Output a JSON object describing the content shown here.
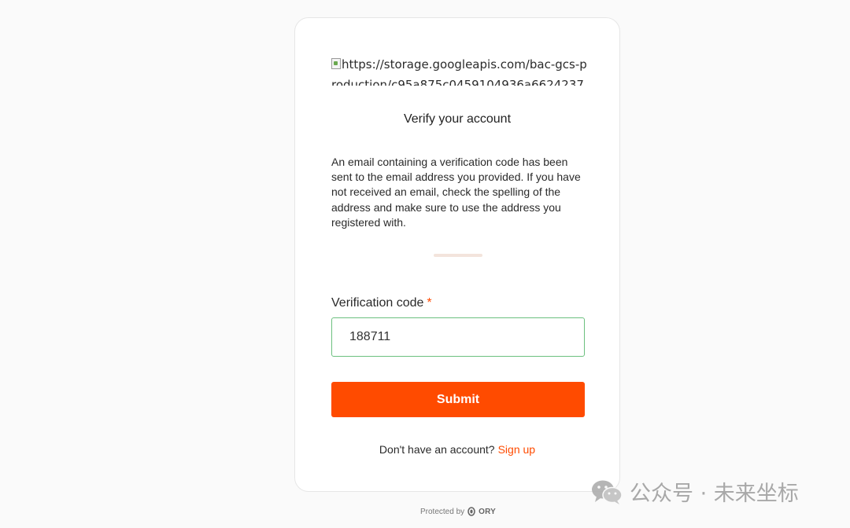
{
  "logo": {
    "broken_image_alt": "https://storage.googleapis.com/bac-gcs-production/c95a875c0459104936a6624237"
  },
  "title": "Verify your account",
  "description": "An email containing a verification code has been sent to the email address you provided. If you have not received an email, check the spelling of the address and make sure to use the address you registered with.",
  "form": {
    "label": "Verification code",
    "required_mark": "*",
    "value": "188711",
    "submit_label": "Submit"
  },
  "signup": {
    "prompt": "Don't have an account?",
    "link_label": "Sign up"
  },
  "footer": {
    "protected_by": "Protected by",
    "brand": "ORY"
  },
  "watermark": {
    "text": "公众号 · 未来坐标"
  },
  "colors": {
    "accent": "#ff4b00",
    "input_border": "#6cc07f",
    "page_bg": "#fafafa"
  }
}
